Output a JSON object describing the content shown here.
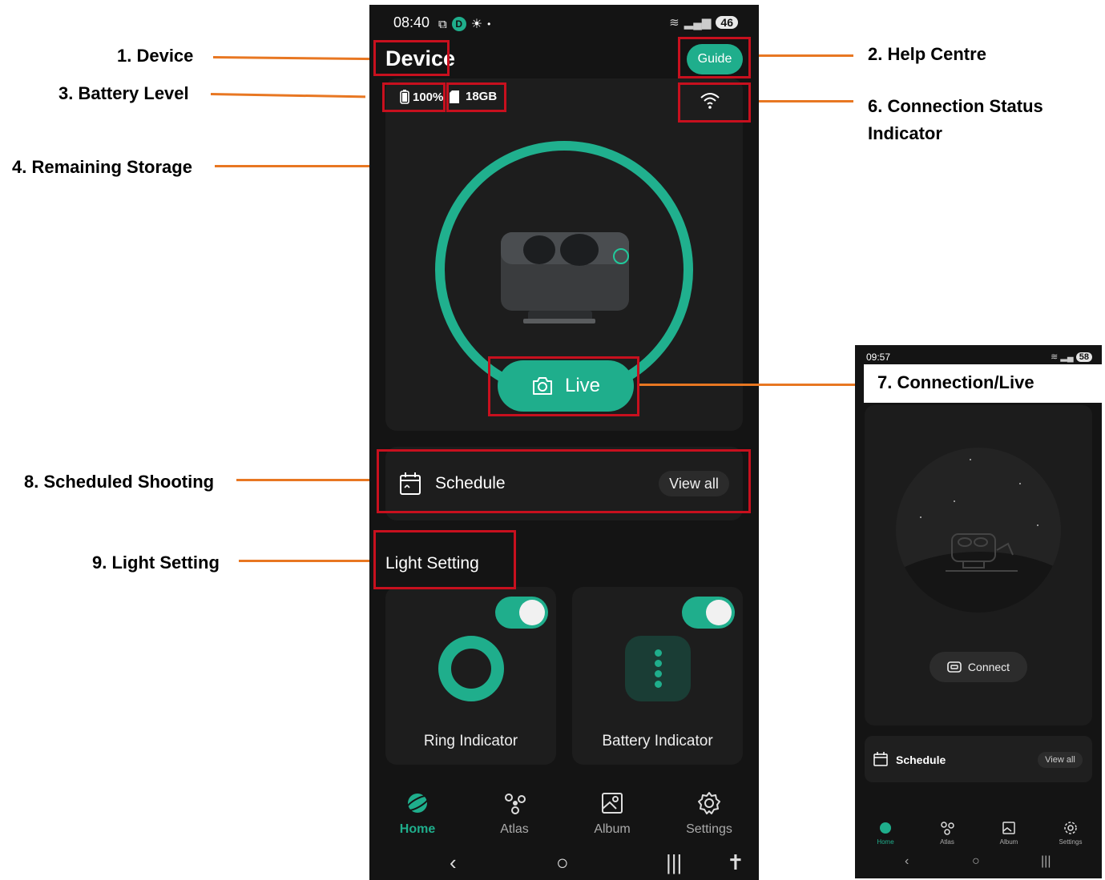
{
  "callouts": {
    "device": "1. Device",
    "help": "2. Help Centre",
    "battery": "3. Battery Level",
    "storage": "4. Remaining Storage",
    "connection_status_1": "6. Connection Status",
    "connection_status_2": "Indicator",
    "connection_live": "7. Connection/Live",
    "schedule": "8. Scheduled Shooting",
    "light": "9. Light Setting"
  },
  "main": {
    "status_time": "08:40",
    "status_battery": "46",
    "title": "Device",
    "guide_label": "Guide",
    "battery_level": "100%",
    "storage": "18GB",
    "live_label": "Live",
    "schedule_label": "Schedule",
    "view_all": "View all",
    "light_section": "Light Setting",
    "cards": [
      {
        "label": "Ring Indicator",
        "on": true
      },
      {
        "label": "Battery Indicator",
        "on": true
      }
    ],
    "nav": [
      {
        "label": "Home",
        "icon": "home-planet-icon",
        "active": true
      },
      {
        "label": "Atlas",
        "icon": "atlas-nodes-icon",
        "active": false
      },
      {
        "label": "Album",
        "icon": "album-image-icon",
        "active": false
      },
      {
        "label": "Settings",
        "icon": "gear-icon",
        "active": false
      }
    ]
  },
  "mini": {
    "status_time": "09:57",
    "status_battery": "58",
    "connect_label": "Connect",
    "schedule_label": "Schedule",
    "view_all": "View all",
    "nav": [
      {
        "label": "Home"
      },
      {
        "label": "Atlas"
      },
      {
        "label": "Album"
      },
      {
        "label": "Settings"
      }
    ]
  },
  "colors": {
    "accent": "#1fae8c",
    "callout_line": "#E87722",
    "highlight_box": "#C8101E",
    "background": "#141414"
  }
}
